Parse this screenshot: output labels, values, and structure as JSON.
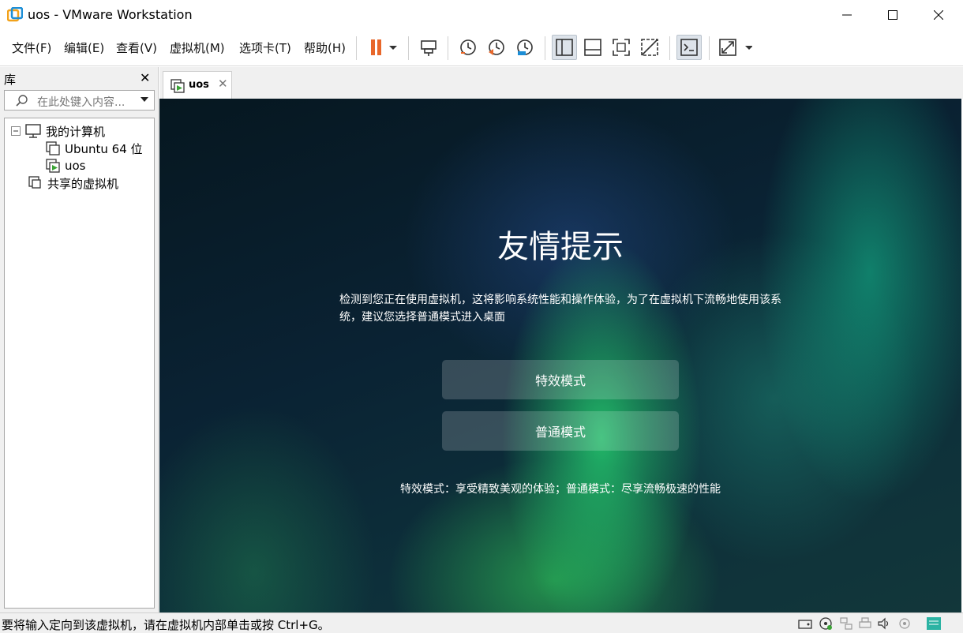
{
  "window": {
    "title": "uos - VMware Workstation"
  },
  "menu": [
    "文件(F)",
    "编辑(E)",
    "查看(V)",
    "虚拟机(M)",
    "选项卡(T)",
    "帮助(H)"
  ],
  "library": {
    "title": "库",
    "search_placeholder": "在此处键入内容...",
    "tree": [
      {
        "label": "我的计算机",
        "type": "computer"
      },
      {
        "label": "Ubuntu 64 位",
        "type": "vm"
      },
      {
        "label": "uos",
        "type": "vm-running"
      },
      {
        "label": "共享的虚拟机",
        "type": "shared"
      }
    ]
  },
  "tab": {
    "label": "uos"
  },
  "guest": {
    "title": "友情提示",
    "message": "检测到您正在使用虚拟机，这将影响系统性能和操作体验，为了在虚拟机下流畅地使用该系统，建议您选择普通模式进入桌面",
    "effect_button": "特效模式",
    "normal_button": "普通模式",
    "hint": "特效模式：享受精致美观的体验；普通模式：尽享流畅极速的性能"
  },
  "status": {
    "text": "要将输入定向到该虚拟机，请在虚拟机内部单击或按 Ctrl+G。"
  },
  "colors": {
    "pause_accent": "#e8672a",
    "vm_running": "#3aa335"
  }
}
